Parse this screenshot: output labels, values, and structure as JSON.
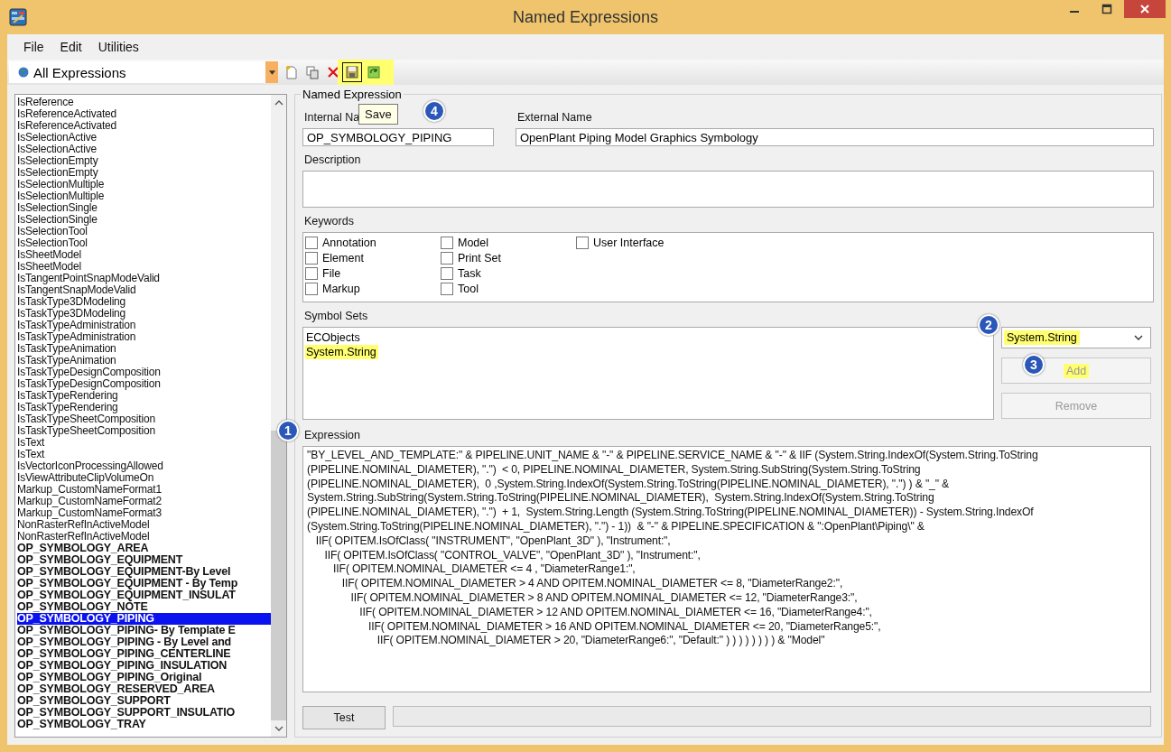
{
  "window": {
    "title": "Named Expressions"
  },
  "menu": [
    "File",
    "Edit",
    "Utilities"
  ],
  "toolbar": {
    "filter": "All Expressions",
    "tooltip": "Save"
  },
  "list": {
    "items": [
      {
        "label": "IsReference",
        "bold": false,
        "selected": false
      },
      {
        "label": "IsReferenceActivated",
        "bold": false,
        "selected": false
      },
      {
        "label": "IsReferenceActivated",
        "bold": false,
        "selected": false
      },
      {
        "label": "IsSelectionActive",
        "bold": false,
        "selected": false
      },
      {
        "label": "IsSelectionActive",
        "bold": false,
        "selected": false
      },
      {
        "label": "IsSelectionEmpty",
        "bold": false,
        "selected": false
      },
      {
        "label": "IsSelectionEmpty",
        "bold": false,
        "selected": false
      },
      {
        "label": "IsSelectionMultiple",
        "bold": false,
        "selected": false
      },
      {
        "label": "IsSelectionMultiple",
        "bold": false,
        "selected": false
      },
      {
        "label": "IsSelectionSingle",
        "bold": false,
        "selected": false
      },
      {
        "label": "IsSelectionSingle",
        "bold": false,
        "selected": false
      },
      {
        "label": "IsSelectionTool",
        "bold": false,
        "selected": false
      },
      {
        "label": "IsSelectionTool",
        "bold": false,
        "selected": false
      },
      {
        "label": "IsSheetModel",
        "bold": false,
        "selected": false
      },
      {
        "label": "IsSheetModel",
        "bold": false,
        "selected": false
      },
      {
        "label": "IsTangentPointSnapModeValid",
        "bold": false,
        "selected": false
      },
      {
        "label": "IsTangentSnapModeValid",
        "bold": false,
        "selected": false
      },
      {
        "label": "IsTaskType3DModeling",
        "bold": false,
        "selected": false
      },
      {
        "label": "IsTaskType3DModeling",
        "bold": false,
        "selected": false
      },
      {
        "label": "IsTaskTypeAdministration",
        "bold": false,
        "selected": false
      },
      {
        "label": "IsTaskTypeAdministration",
        "bold": false,
        "selected": false
      },
      {
        "label": "IsTaskTypeAnimation",
        "bold": false,
        "selected": false
      },
      {
        "label": "IsTaskTypeAnimation",
        "bold": false,
        "selected": false
      },
      {
        "label": "IsTaskTypeDesignComposition",
        "bold": false,
        "selected": false
      },
      {
        "label": "IsTaskTypeDesignComposition",
        "bold": false,
        "selected": false
      },
      {
        "label": "IsTaskTypeRendering",
        "bold": false,
        "selected": false
      },
      {
        "label": "IsTaskTypeRendering",
        "bold": false,
        "selected": false
      },
      {
        "label": "IsTaskTypeSheetComposition",
        "bold": false,
        "selected": false
      },
      {
        "label": "IsTaskTypeSheetComposition",
        "bold": false,
        "selected": false
      },
      {
        "label": "IsText",
        "bold": false,
        "selected": false
      },
      {
        "label": "IsText",
        "bold": false,
        "selected": false
      },
      {
        "label": "IsVectorIconProcessingAllowed",
        "bold": false,
        "selected": false
      },
      {
        "label": "IsViewAttributeClipVolumeOn",
        "bold": false,
        "selected": false
      },
      {
        "label": "Markup_CustomNameFormat1",
        "bold": false,
        "selected": false
      },
      {
        "label": "Markup_CustomNameFormat2",
        "bold": false,
        "selected": false
      },
      {
        "label": "Markup_CustomNameFormat3",
        "bold": false,
        "selected": false
      },
      {
        "label": "NonRasterRefInActiveModel",
        "bold": false,
        "selected": false
      },
      {
        "label": "NonRasterRefInActiveModel",
        "bold": false,
        "selected": false
      },
      {
        "label": "OP_SYMBOLOGY_AREA",
        "bold": true,
        "selected": false
      },
      {
        "label": "OP_SYMBOLOGY_EQUIPMENT",
        "bold": true,
        "selected": false
      },
      {
        "label": "OP_SYMBOLOGY_EQUIPMENT-By Level",
        "bold": true,
        "selected": false
      },
      {
        "label": "OP_SYMBOLOGY_EQUIPMENT - By Temp",
        "bold": true,
        "selected": false
      },
      {
        "label": "OP_SYMBOLOGY_EQUIPMENT_INSULAT",
        "bold": true,
        "selected": false
      },
      {
        "label": "OP_SYMBOLOGY_NOTE",
        "bold": true,
        "selected": false
      },
      {
        "label": "OP_SYMBOLOGY_PIPING",
        "bold": true,
        "selected": true
      },
      {
        "label": "OP_SYMBOLOGY_PIPING- By Template E",
        "bold": true,
        "selected": false
      },
      {
        "label": "OP_SYMBOLOGY_PIPING - By Level and",
        "bold": true,
        "selected": false
      },
      {
        "label": "OP_SYMBOLOGY_PIPING_CENTERLINE",
        "bold": true,
        "selected": false
      },
      {
        "label": "OP_SYMBOLOGY_PIPING_INSULATION",
        "bold": true,
        "selected": false
      },
      {
        "label": "OP_SYMBOLOGY_PIPING_Original",
        "bold": true,
        "selected": false
      },
      {
        "label": "OP_SYMBOLOGY_RESERVED_AREA",
        "bold": true,
        "selected": false
      },
      {
        "label": "OP_SYMBOLOGY_SUPPORT",
        "bold": true,
        "selected": false
      },
      {
        "label": "OP_SYMBOLOGY_SUPPORT_INSULATIO",
        "bold": true,
        "selected": false
      },
      {
        "label": "OP_SYMBOLOGY_TRAY",
        "bold": true,
        "selected": false
      }
    ]
  },
  "form": {
    "group_title": "Named Expression",
    "internal_name_label": "Internal Na",
    "internal_name": "OP_SYMBOLOGY_PIPING",
    "external_name_label": "External Name",
    "external_name": "OpenPlant Piping Model Graphics Symbology",
    "description_label": "Description",
    "keywords_label": "Keywords",
    "keywords": [
      {
        "label": "Annotation",
        "checked": false
      },
      {
        "label": "Element",
        "checked": false
      },
      {
        "label": "File",
        "checked": false
      },
      {
        "label": "Markup",
        "checked": false
      },
      {
        "label": "Model",
        "checked": false
      },
      {
        "label": "Print Set",
        "checked": false
      },
      {
        "label": "Task",
        "checked": false
      },
      {
        "label": "Tool",
        "checked": false
      },
      {
        "label": "User Interface",
        "checked": false
      }
    ],
    "symbol_sets_label": "Symbol Sets",
    "symbol_sets": [
      {
        "label": "ECObjects",
        "highlighted": false
      },
      {
        "label": "System.String",
        "highlighted": true
      }
    ],
    "symbol_choice": "System.String",
    "add_button": "Add",
    "remove_button": "Remove",
    "expression_label": "Expression",
    "expression_lines": [
      "\"BY_LEVEL_AND_TEMPLATE:\" & PIPELINE.UNIT_NAME & \"-\" & PIPELINE.SERVICE_NAME & \"-\" & IIF (System.String.IndexOf(System.String.ToString",
      "(PIPELINE.NOMINAL_DIAMETER), \".\")  < 0, PIPELINE.NOMINAL_DIAMETER, System.String.SubString(System.String.ToString",
      "(PIPELINE.NOMINAL_DIAMETER),  0 ,System.String.IndexOf(System.String.ToString(PIPELINE.NOMINAL_DIAMETER), \".\") ) & \"_\" &",
      "System.String.SubString(System.String.ToString(PIPELINE.NOMINAL_DIAMETER),  System.String.IndexOf(System.String.ToString",
      "(PIPELINE.NOMINAL_DIAMETER), \".\")  + 1,  System.String.Length (System.String.ToString(PIPELINE.NOMINAL_DIAMETER)) - System.String.IndexOf",
      "(System.String.ToString(PIPELINE.NOMINAL_DIAMETER), \".\") - 1))  & \"-\" & PIPELINE.SPECIFICATION & \":OpenPlant\\Piping\\\" &",
      "   IIF( OPITEM.IsOfClass( \"INSTRUMENT\", \"OpenPlant_3D\" ), \"Instrument:\",",
      "      IIF( OPITEM.IsOfClass( \"CONTROL_VALVE\", \"OpenPlant_3D\" ), \"Instrument:\",",
      "         IIF( OPITEM.NOMINAL_DIAMETER <= 4 , \"DiameterRange1:\",",
      "            IIF( OPITEM.NOMINAL_DIAMETER > 4 AND OPITEM.NOMINAL_DIAMETER <= 8, \"DiameterRange2:\",",
      "               IIF( OPITEM.NOMINAL_DIAMETER > 8 AND OPITEM.NOMINAL_DIAMETER <= 12, \"DiameterRange3:\",",
      "                  IIF( OPITEM.NOMINAL_DIAMETER > 12 AND OPITEM.NOMINAL_DIAMETER <= 16, \"DiameterRange4:\",",
      "                     IIF( OPITEM.NOMINAL_DIAMETER > 16 AND OPITEM.NOMINAL_DIAMETER <= 20, \"DiameterRange5:\",",
      "                        IIF( OPITEM.NOMINAL_DIAMETER > 20, \"DiameterRange6:\", \"Default:\" ) ) ) ) ) ) ) ) & \"Model\""
    ],
    "test_button": "Test"
  },
  "callouts": [
    "1",
    "2",
    "3",
    "4"
  ]
}
